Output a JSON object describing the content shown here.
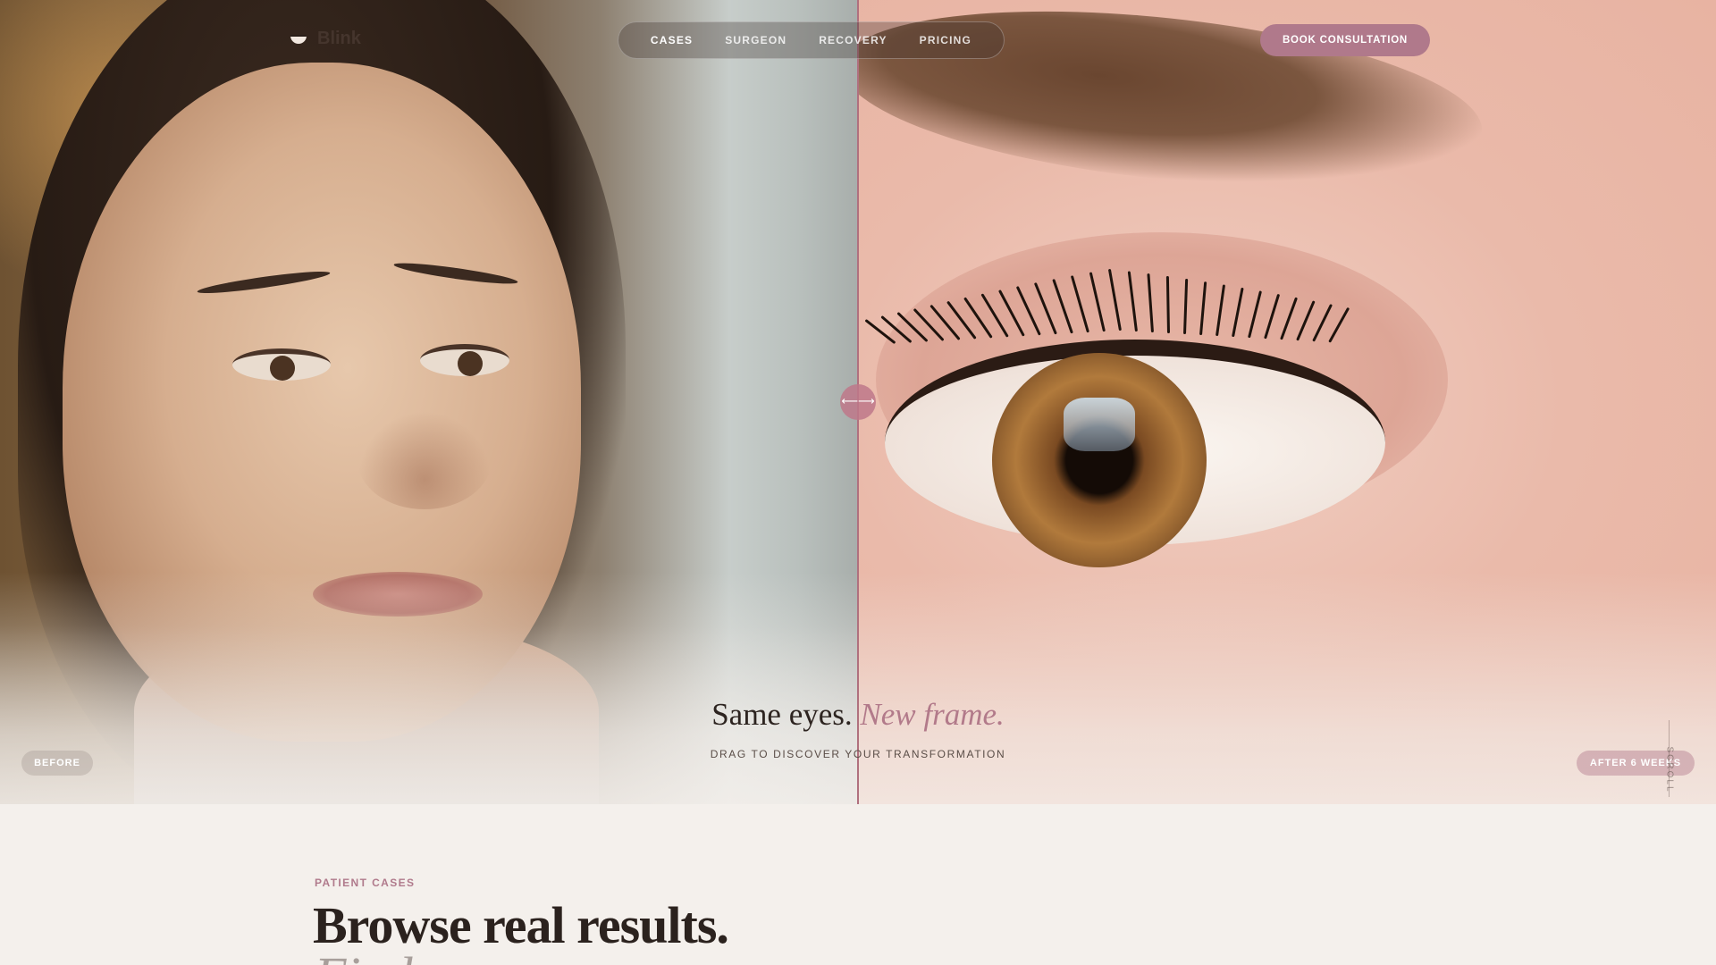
{
  "brand": {
    "name": "Blink"
  },
  "nav": {
    "items": [
      {
        "label": "CASES"
      },
      {
        "label": "SURGEON"
      },
      {
        "label": "RECOVERY"
      },
      {
        "label": "PRICING"
      }
    ]
  },
  "cta": {
    "label": "BOOK CONSULTATION"
  },
  "hero": {
    "headline_main": "Same eyes.",
    "headline_accent": "New frame.",
    "subline": "DRAG TO DISCOVER YOUR TRANSFORMATION",
    "before_label": "BEFORE",
    "after_label": "AFTER 6 WEEKS",
    "drag_glyph": "⟵⟶",
    "scroll_label": "SCROLL",
    "slider_position_percent": 50
  },
  "section": {
    "eyebrow": "PATIENT CASES",
    "title": "Browse real results.",
    "title_second_line": "Find"
  },
  "colors": {
    "accent": "#b0798b",
    "text_dark": "#2d2420",
    "background": "#f4f0ec"
  }
}
